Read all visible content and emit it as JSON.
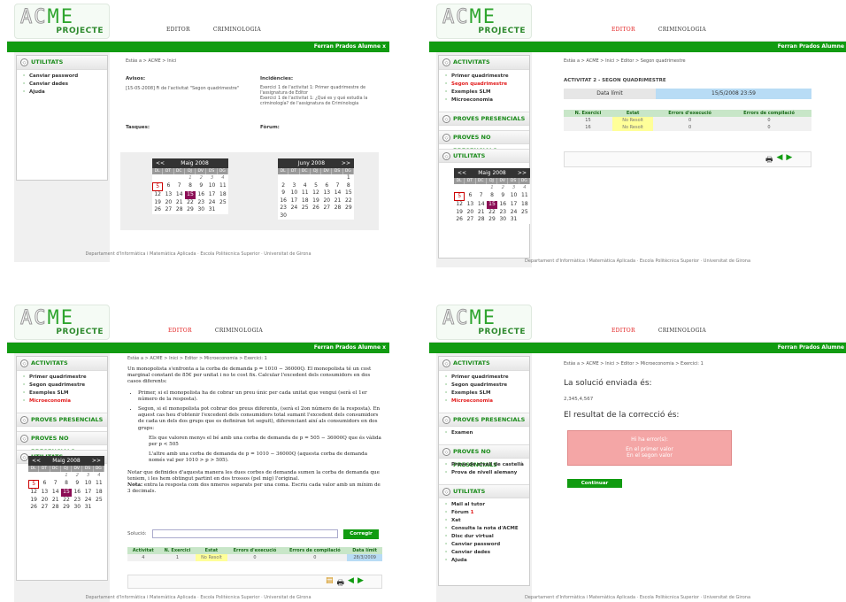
{
  "brand": {
    "logo_text": "PROJECTE",
    "logo_lettering": "ACME"
  },
  "colors": {
    "green": "#119b11",
    "active": "#e21b1b",
    "selected_day": "#8b0d55"
  },
  "user": "Ferran Prados Alumne",
  "footer": "Departament d'Informàtica i Matemàtica Aplicada · Escola Politècnica Superior · Universitat de Girona",
  "p1": {
    "nav": [
      "EDITOR",
      "CRIMINOLOGIA"
    ],
    "user_suffix": "x",
    "sidebar": {
      "section": "UTILITATS",
      "items": [
        "Canviar password",
        "Canviar dades",
        "Ajuda"
      ]
    },
    "crumb": "Estàs a > ACME > Inici",
    "avisos_title": "Avisos:",
    "avisos_text": "[15-05-2008] Fi de l'activitat \"Segon quadrimestre\"",
    "incidencies_title": "Incidències:",
    "incidencies_text": "Exercici 1 de l'activitat 1: Primer quadrimestre de l'assignatura de Editor\nExercici 1 de l'activitat 1: ¿Qué es y qué estudia la criminología? de l'assignatura de Criminologia",
    "tasques_title": "Tasques:",
    "forum_title": "Fòrum:",
    "cal1": {
      "prev": "<<",
      "month": "Maig 2008",
      "next": ">>"
    },
    "cal2": {
      "prev": "<<",
      "month": "Juny 2008",
      "next": ">>"
    }
  },
  "p2": {
    "nav": [
      "EDITOR",
      "CRIMINOLOGIA"
    ],
    "sidebar": {
      "activitats": "ACTIVITATS",
      "items": [
        "Primer quadrimestre",
        "Segon quadrimestre",
        "Exemples SLM",
        "Microeconomia"
      ],
      "proves": "PROVES PRESENCIALS",
      "noproves": "PROVES NO PRESENCIALS",
      "utilitats": "UTILITATS"
    },
    "crumb": "Estàs a > ACME > Inici > Editor > Segon quadrimestre",
    "heading": "ACTIVITAT 2 - SEGON QUADRIMESTRE",
    "data_limit_label": "Data límit",
    "data_limit_value": "15/5/2008 23:59",
    "table": {
      "headers": [
        "N. Exercici",
        "Estat",
        "Errors d'execució",
        "Errors de compilació"
      ],
      "rows": [
        [
          "15",
          "No Resolt",
          "0",
          "0"
        ],
        [
          "16",
          "No Resolt",
          "0",
          "0"
        ]
      ]
    },
    "cal": {
      "prev": "<<",
      "month": "Maig 2008",
      "next": ">>"
    }
  },
  "p3": {
    "nav": [
      "EDITOR",
      "CRIMINOLOGIA"
    ],
    "user_suffix": "x",
    "sidebar": {
      "activitats": "ACTIVITATS",
      "items": [
        "Primer quadrimestre",
        "Segon quadrimestre",
        "Exemples SLM",
        "Microeconomia"
      ],
      "proves": "PROVES PRESENCIALS",
      "noproves": "PROVES NO PRESENCIALS",
      "utilitats": "UTILITATS"
    },
    "crumb": "Estàs a > ACME > Inici > Editor > Microeconomia > Exercici: 1",
    "para1": "Un monopolista s'enfronta a la corba de demanda p = 1010 − 36000Q. El monopolista té un cost marginal constant de 85€ per unitat i no te cost fix. Calcular l'excedent dels consumidors en dos casos diferents:",
    "bullet1": "Primer, si el monopolista ha de cobrar un preu únic per cada unitat que vengui (serà el 1er número de la resposta).",
    "bullet2": "Segon, si el monopolista pot cobrar dos preus diferents, (serà el 2on número de la resposta). En aquest cas heu d'obtenir l'excedent dels consumidors total sumant l'excedent dels consumidors de cada un dels dos grups que es definiran tot seguit), diferenciant així als consumidors en dos grups:",
    "sub1": "Els que valoren menys el bé amb una corba de demanda de p = 505 − 36000Q que és vàlida per p < 505",
    "sub2": "L'altre amb una corba de demanda de p = 1010 − 36000Q (aquesta corba de demanda només val per 1010 > p > 505).",
    "para2": "Notar que definides d'aquesta manera les dues corbes de demanda sumen la corba de demanda que teniem, i les hem obtingut partint en dos trossos (pel mig) l'original.",
    "nota_label": "Nota:",
    "nota": " entra la resposta com dos nmeros separats per una coma. Escriu cada valor amb un mínim de 3 decimals.",
    "solucio_label": "Solució:",
    "solucio_value": "",
    "corregir": "Corregir",
    "table": {
      "headers": [
        "Activitat",
        "N. Exercici",
        "Estat",
        "Errors d'execució",
        "Errors de compilació",
        "Data límit"
      ],
      "row": [
        "4",
        "1",
        "No Resolt",
        "0",
        "0",
        "28/3/2009"
      ]
    },
    "cal": {
      "prev": "<<",
      "month": "Maig 2008",
      "next": ">>"
    }
  },
  "p4": {
    "nav": [
      "EDITOR",
      "CRIMINOLOGIA"
    ],
    "sidebar": {
      "activitats": "ACTIVITATS",
      "items": [
        "Primer quadrimestre",
        "Segon quadrimestre",
        "Exemples SLM",
        "Microeconomia"
      ],
      "proves": "PROVES PRESENCIALS",
      "proves_items": [
        "Examen"
      ],
      "noproves": "PROVES NO PRESENCIALS",
      "noproves_items": [
        "Prova de nivell de castellà",
        "Prova de nivell alemany"
      ],
      "utilitats": "UTILITATS",
      "util_items": [
        "Mail al tutor",
        "Fòrum",
        "Xat",
        "Consulta la nota d'ACME",
        "Disc dur virtual",
        "Canviar password",
        "Canviar dades",
        "Ajuda"
      ],
      "forum_badge": "1"
    },
    "crumb": "Estàs a > ACME > Inici > Editor > Microeconomia > Exercici: 1",
    "sol_heading": "La solució enviada és:",
    "sol_value": "2,345,4,567",
    "res_heading": "El resultat de la correcció és:",
    "err_title": "Hi ha error(s):",
    "err1": "En el primer valor",
    "err2": "En el segon valor",
    "continuar": "Continuar"
  }
}
